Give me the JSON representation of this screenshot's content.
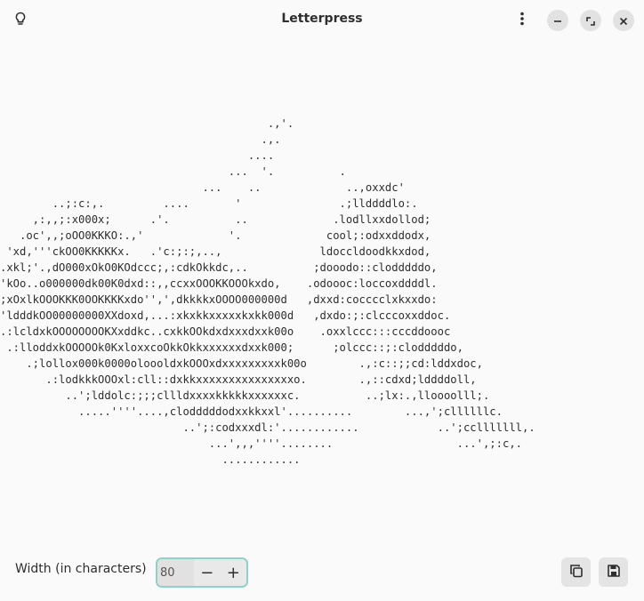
{
  "header": {
    "title": "Letterpress",
    "tips_icon": "lightbulb-icon",
    "menu_icon": "kebab-menu-icon",
    "minimize_icon": "minimize-icon",
    "maximize_icon": "maximize-icon",
    "close_icon": "close-icon"
  },
  "art": {
    "lines": [
      "                                         .,'.",
      "                                        .,.",
      "                                      ....",
      "                                   ...  '.          .",
      "                               ...    ..             ..,oxxdc'",
      "        ..;:c:,.         ....       '               .;llddddlo:.",
      "     ,:,,;:x000x;      .'.          ..             .lodllxxdollod;",
      "   .oc',,;oOO0KKKO:.,'             '.             cool;:odxxddodx,",
      " 'xd,'''ckOO0KKKKKx.   .'c:;:;,..,               ldoccldoodkkxdod,",
      ".xkl;'.,dO000xOkO0KOdccc;,:cdkOkkdc,..          ;dooodo::clodddddo,",
      "'kOo..o000000dk00K0dxd::,,ccxxOOOKKOOOkxdo,    .odoooc:loccoxddddl.",
      ";xOxlkOOOKKK0OOKKKKxdo'',',dkkkkxOOOO000000d   ,dxxd:cocccclxkxxdo:",
      "'ldddkOO00000000XXdoxd,...:xkxkkxxxxxkxkk000d   ,dxdo:;:clcccoxxddoc.",
      ".:lcldxkOOOOOOOOKXxddkc..cxkkOOkdxdxxxdxxk00o    .oxxlccc:::cccddoooc",
      " .:lloddxkOOOOOk0KxloxxcoOkkOkkxxxxxxdxxk000;      ;olccc::;:clodddddo,",
      "    .;lollox000k0000oloooldxkOOOxdxxxxxxxxxk00o        .,:c::;;cd:lddxdoc,",
      "       .:lodkkkOOOxl:cll::dxkkxxxxxxxxxxxxxxxo.        .,::cdxd;lddddoll,",
      "          ..';lddolc:;;;cllldxxxxkkkkkxxxxxxc.          ..;lx:.,lloooolll;.",
      "            .....''''....,clodddddodxxkkxxl'..........        ...,';cllllllc.",
      "                            ..';:codxxxdl:'............            ..';cclllllll,.",
      "                                ...',,,''''........                   ...',;:c,.",
      "                                  ............"
    ]
  },
  "footer": {
    "width_label": "Width (in characters)",
    "width_value": "80",
    "decrement_label": "−",
    "increment_label": "+",
    "copy_icon": "copy-icon",
    "save_icon": "save-icon"
  }
}
